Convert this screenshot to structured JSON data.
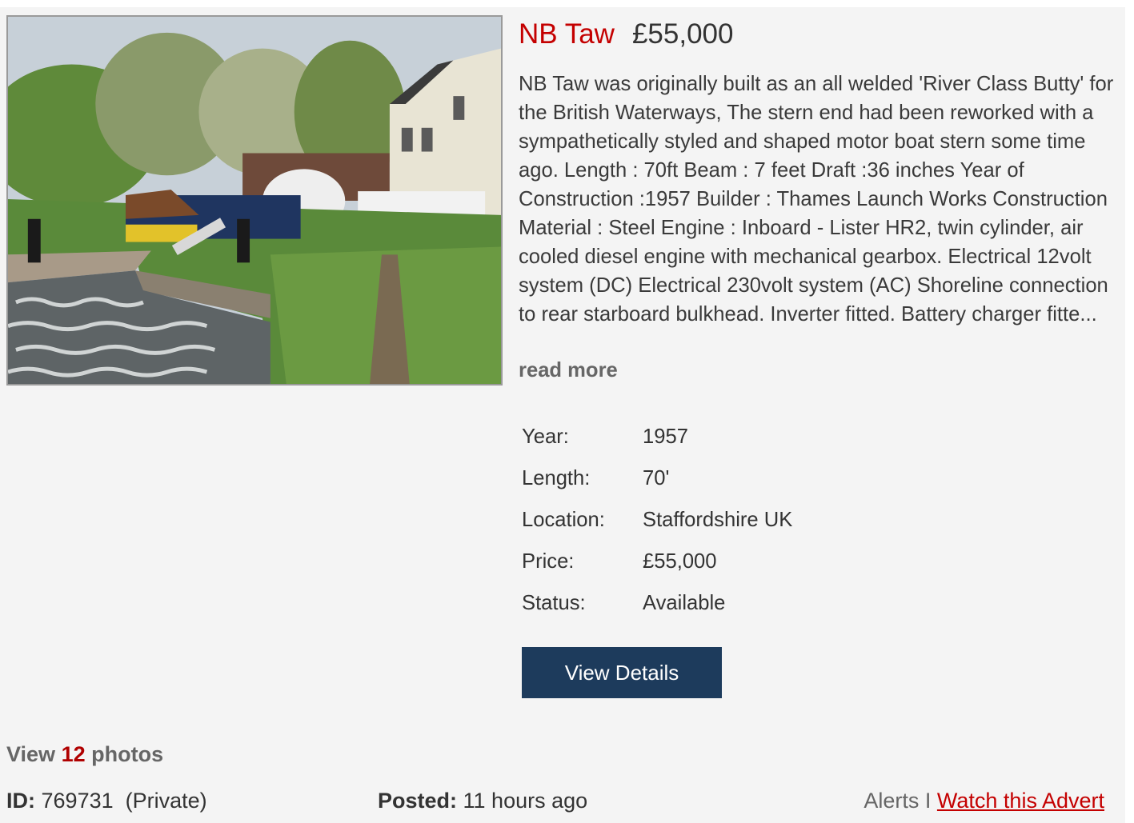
{
  "listing": {
    "name": "NB Taw",
    "price": "£55,000",
    "description": "NB Taw was originally built as an all welded 'River Class Butty' for the British Waterways, The stern end had been reworked with a sympathetically styled and shaped motor boat stern some time ago. Length : 70ft Beam : 7 feet Draft :36 inches Year of Construction :1957 Builder : Thames Launch Works Construction Material : Steel Engine : Inboard - Lister HR2, twin cylinder, air cooled diesel engine with mechanical gearbox. Electrical 12volt system (DC) Electrical 230volt system (AC) Shoreline connection to rear starboard bulkhead. Inverter fitted. Battery charger fitte...",
    "read_more": "read more",
    "photo_icon": "canal-narrowboat-photo"
  },
  "specs": [
    {
      "label": "Year:",
      "value": "1957"
    },
    {
      "label": "Length:",
      "value": "70'"
    },
    {
      "label": "Location:",
      "value": "Staffordshire UK"
    },
    {
      "label": "Price:",
      "value": "£55,000"
    },
    {
      "label": "Status:",
      "value": "Available"
    }
  ],
  "button": {
    "label": "View Details"
  },
  "photos": {
    "prefix": "View",
    "count": "12",
    "suffix": "photos"
  },
  "footer": {
    "id_label": "ID:",
    "id_value": "769731",
    "seller_type": "(Private)",
    "posted_label": "Posted:",
    "posted_value": "11 hours ago",
    "alerts_label": "Alerts",
    "separator": "I",
    "watch_label": "Watch this Advert"
  },
  "colors": {
    "title_red": "#c40000",
    "button_navy": "#1d3b5c",
    "background": "#f4f4f4"
  }
}
